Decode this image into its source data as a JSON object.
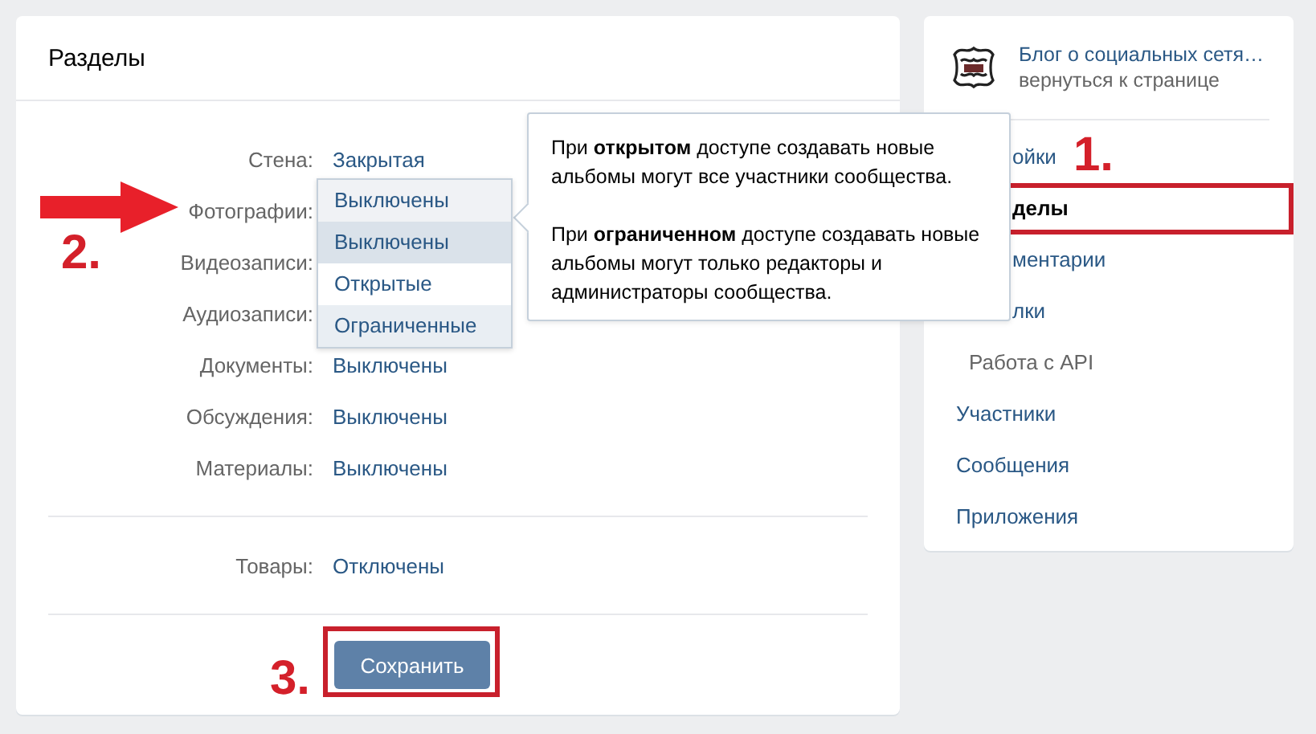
{
  "sections": {
    "title": "Разделы",
    "settings": [
      {
        "label": "Стена:",
        "value": "Закрытая"
      },
      {
        "label": "Фотографии:",
        "dropdown": {
          "value": "Выключены",
          "options": [
            {
              "label": "Выключены",
              "selected": true,
              "hovered": false
            },
            {
              "label": "Открытые",
              "selected": false,
              "hovered": false
            },
            {
              "label": "Ограниченные",
              "selected": false,
              "hovered": true
            }
          ]
        }
      },
      {
        "label": "Видеозаписи:"
      },
      {
        "label": "Аудиозаписи:"
      },
      {
        "label": "Документы:",
        "value": "Выключены"
      },
      {
        "label": "Обсуждения:",
        "value": "Выключены"
      },
      {
        "label": "Материалы:",
        "value": "Выключены"
      }
    ],
    "goods": {
      "label": "Товары:",
      "value": "Отключены"
    },
    "save_button": "Сохранить"
  },
  "tooltip": {
    "paragraphs": [
      "При **открытом** доступе создавать новые альбомы могут все участники сообщества.",
      "При **ограниченном** доступе создавать новые альбомы могут только редакторы и администраторы сообщества."
    ]
  },
  "sidebar": {
    "community": {
      "name": "Блог о социальных сетя…",
      "link": "вернуться к странице"
    },
    "items": [
      {
        "label": "ойки",
        "selected": false
      },
      {
        "label": "делы",
        "selected": true
      },
      {
        "label": "ментарии",
        "selected": false
      },
      {
        "label": "лки",
        "selected": false,
        "children": [
          {
            "label": "Работа с API",
            "selected": false
          }
        ]
      },
      {
        "label": "Участники",
        "selected": false
      },
      {
        "label": "Сообщения",
        "selected": false
      },
      {
        "label": "Приложения",
        "selected": false
      }
    ]
  },
  "annotations": {
    "markers": [
      "1.",
      "2.",
      "3."
    ]
  }
}
